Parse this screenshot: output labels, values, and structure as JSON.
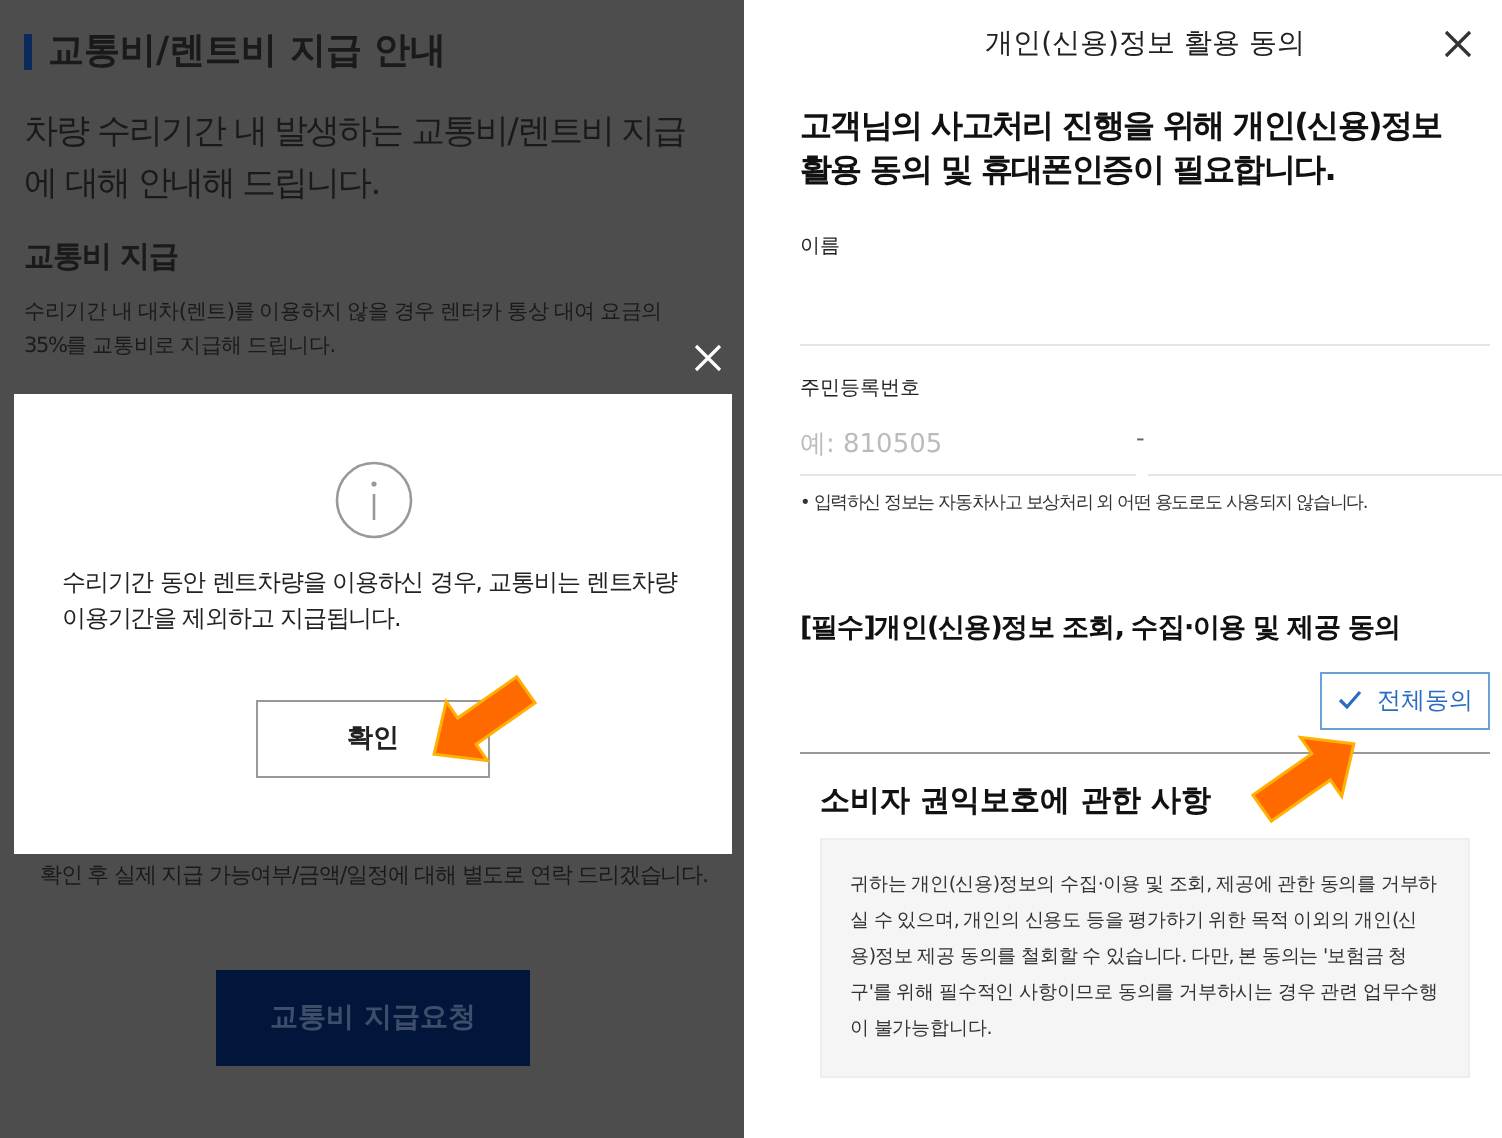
{
  "left_screen": {
    "title": "교통비/렌트비 지급 안내",
    "intro": "차량 수리기간 내 발생하는 교통비/렌트비 지급에 대해 안내해 드립니다.",
    "section_title": "교통비 지급",
    "section_text": "수리기간 내 대차(렌트)를 이용하지 않을 경우 렌터카 통상 대여 요금의 35%를 교통비로 지급해 드립니다.",
    "notice_text": "확인 후 실제 지급 가능여부/금액/일정에 대해 별도로 연락 드리겠습니다.",
    "request_button": "교통비 지급요청",
    "dialog": {
      "message": "수리기간 동안 렌트차량을 이용하신 경우, 교통비는 렌트차량 이용기간을 제외하고 지급됩니다.",
      "confirm_button": "확인"
    }
  },
  "right_screen": {
    "title": "개인(신용)정보 활용 동의",
    "heading": "고객님의 사고처리 진행을 위해 개인(신용)정보 활용 동의 및 휴대폰인증이 필요합니다.",
    "name_field": {
      "label": "이름"
    },
    "id_field": {
      "label": "주민등록번호",
      "placeholder": "예: 810505",
      "separator": "-"
    },
    "note": "• 입력하신 정보는 자동차사고 보상처리 외 어떤 용도로도 사용되지 않습니다.",
    "consent_title": "[필수]개인(신용)정보 조회, 수집·이용 및 제공 동의",
    "agree_all_button": "전체동의",
    "rights_title": "소비자 권익보호에 관한 사항",
    "rights_text": "귀하는 개인(신용)정보의 수집·이용 및 조회, 제공에 관한 동의를 거부하실 수 있으며, 개인의 신용도 등을 평가하기 위한 목적 이외의 개인(신용)정보 제공 동의를 철회할 수 있습니다. 다만, 본 동의는 '보험금 청구'를 위해 필수적인 사항이므로 동의를 거부하시는 경우 관련 업무수행이 불가능합니다."
  }
}
